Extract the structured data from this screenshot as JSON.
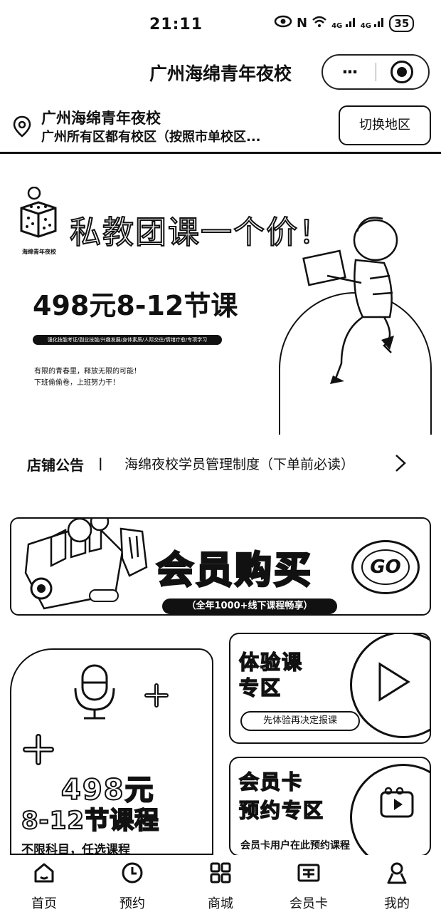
{
  "status_bar": {
    "time": "21:11",
    "network": "N",
    "signal_1": "4G",
    "signal_2": "4G",
    "battery": "35"
  },
  "header": {
    "title": "广州海绵青年夜校",
    "more_icon": "···"
  },
  "location": {
    "name": "广州海绵青年夜校",
    "subtitle": "广州所有区都有校区（按照市单校区...",
    "switch_label": "切换地区"
  },
  "banner": {
    "logo_text": "海绵青年夜校",
    "headline": "私教团课一个价！",
    "price_line": "498元8-12节课",
    "pill_text": "强化技能考证/副业技能/兴趣发展/身体素质/人际交往/情绪疗愈/专项学习",
    "tagline_1": "有限的青春里，释放无限的可能！",
    "tagline_2": "下班偷偷卷，上班努力干！"
  },
  "notice": {
    "label": "店铺公告",
    "separator": "|",
    "text": "海绵夜校学员管理制度（下单前必读）"
  },
  "member_banner": {
    "title": "会员购买",
    "go": "GO",
    "subtitle": "（全年1000+线下课程畅享）"
  },
  "cards": {
    "left": {
      "price": "498元",
      "course": "8-12节课程",
      "note": "不限科目，任选课程"
    },
    "right_top": {
      "title_1": "体验课",
      "title_2": "专区",
      "pill": "先体验再决定报课"
    },
    "right_bottom": {
      "title_1": "会员卡",
      "title_2": "预约专区",
      "note": "会员卡用户在此预约课程"
    }
  },
  "tabs": [
    {
      "label": "首页",
      "icon": "home-icon"
    },
    {
      "label": "预约",
      "icon": "clock-icon"
    },
    {
      "label": "商城",
      "icon": "grid-icon"
    },
    {
      "label": "会员卡",
      "icon": "card-icon"
    },
    {
      "label": "我的",
      "icon": "user-icon"
    }
  ]
}
